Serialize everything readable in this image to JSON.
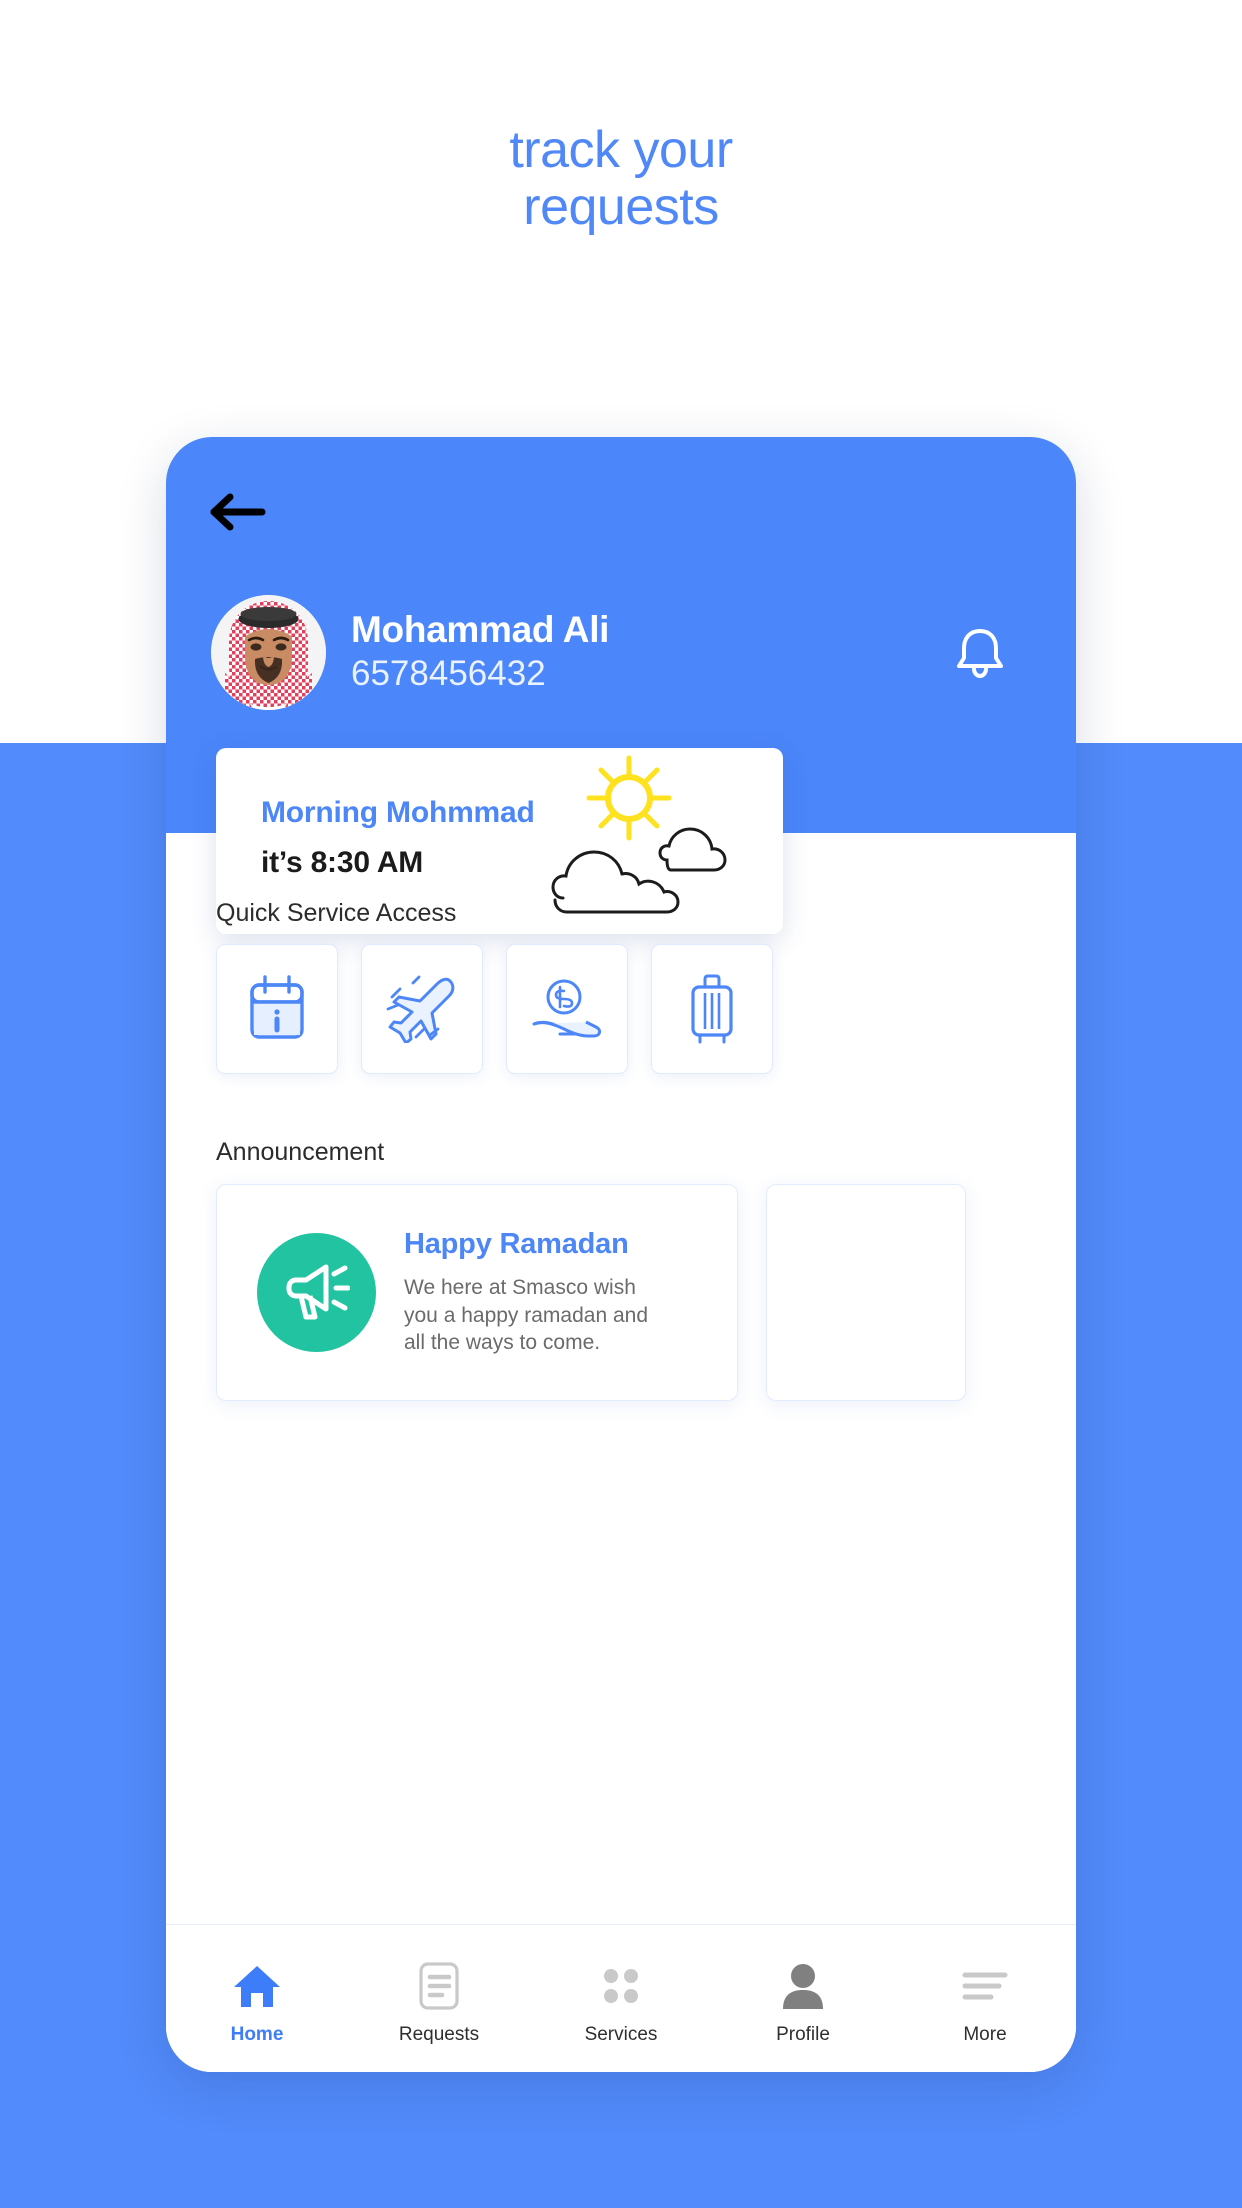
{
  "page": {
    "headline_line1": "track your",
    "headline_line2": "requests",
    "headline_color": "#5188f7",
    "background_blue": "#528bfb"
  },
  "header": {
    "back_icon": "arrow-left-icon",
    "notification_icon": "bell-icon",
    "user_name": "Mohammad Ali",
    "user_phone": "6578456432",
    "avatar_icon": "user-photo-avatar",
    "background_color": "#4b86fa"
  },
  "greeting": {
    "title": "Morning Mohmmad",
    "time_text": "it’s 8:30 AM",
    "art_icon": "sun-and-clouds-icon",
    "title_color": "#4c86f7",
    "sun_color": "#ffe21f"
  },
  "quick_service": {
    "label": "Quick Service Access",
    "tiles": [
      {
        "icon": "calendar-info-icon",
        "name": "calendar"
      },
      {
        "icon": "airplane-icon",
        "name": "flight"
      },
      {
        "icon": "money-in-hand-icon",
        "name": "finance"
      },
      {
        "icon": "suitcase-icon",
        "name": "luggage"
      }
    ]
  },
  "announcement": {
    "label": "Announcement",
    "cards": [
      {
        "icon": "megaphone-icon",
        "icon_bg": "#21c3a1",
        "title": "Happy Ramadan",
        "description": "We here at Smasco wish you a happy ramadan and all the ways to come."
      }
    ]
  },
  "bottom_nav": {
    "active_color": "#3d7df9",
    "items": [
      {
        "label": "Home",
        "icon": "home-icon",
        "active": true
      },
      {
        "label": "Requests",
        "icon": "document-icon",
        "active": false
      },
      {
        "label": "Services",
        "icon": "grid-dots-icon",
        "active": false
      },
      {
        "label": "Profile",
        "icon": "person-icon",
        "active": false
      },
      {
        "label": "More",
        "icon": "hamburger-menu-icon",
        "active": false
      }
    ]
  }
}
